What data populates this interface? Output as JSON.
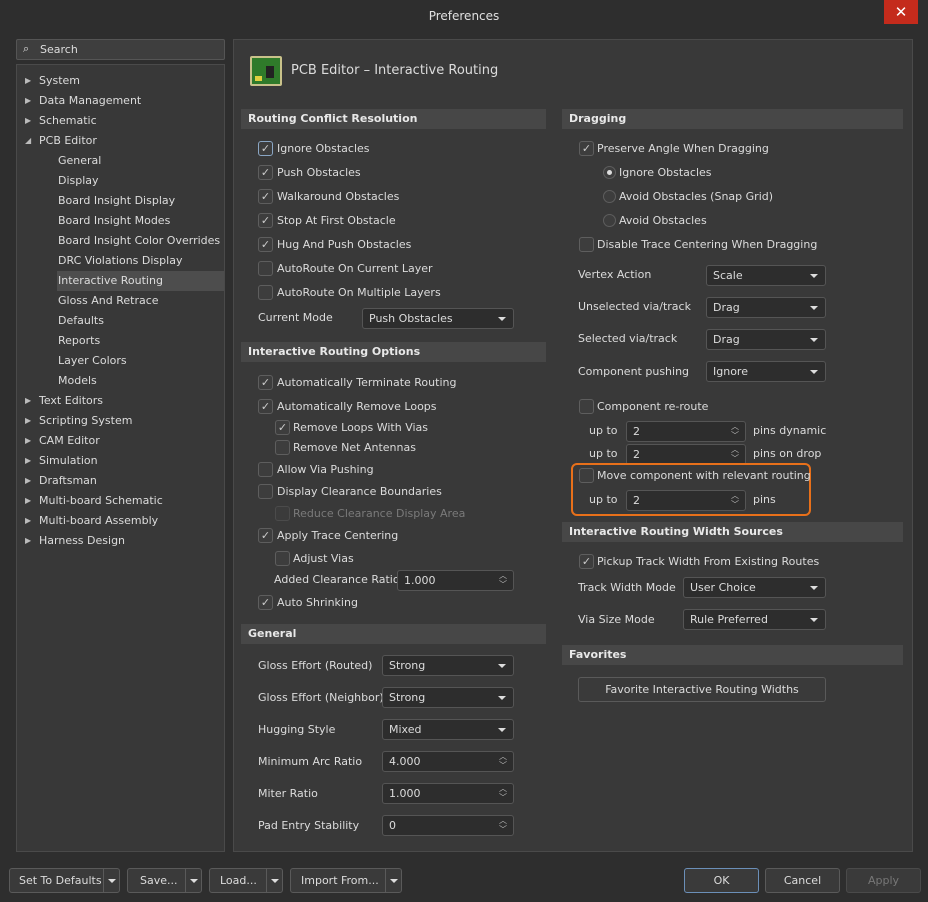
{
  "window": {
    "title": "Preferences",
    "close": "✕"
  },
  "search": {
    "placeholder": "Search"
  },
  "tree": [
    "System",
    "Data Management",
    "Schematic",
    "PCB Editor",
    "General",
    "Display",
    "Board Insight Display",
    "Board Insight Modes",
    "Board Insight Color Overrides",
    "DRC Violations Display",
    "Interactive Routing",
    "Gloss And Retrace",
    "Defaults",
    "Reports",
    "Layer Colors",
    "Models",
    "Text Editors",
    "Scripting System",
    "CAM Editor",
    "Simulation",
    "Draftsman",
    "Multi-board Schematic",
    "Multi-board Assembly",
    "Harness Design"
  ],
  "page_title": "PCB Editor – Interactive Routing",
  "rcr": {
    "title": "Routing Conflict Resolution",
    "items": [
      "Ignore Obstacles",
      "Push Obstacles",
      "Walkaround Obstacles",
      "Stop At First Obstacle",
      "Hug And Push Obstacles",
      "AutoRoute On Current Layer",
      "AutoRoute On Multiple Layers"
    ],
    "mode_label": "Current Mode",
    "mode_value": "Push Obstacles"
  },
  "iro": {
    "title": "Interactive Routing Options",
    "items": [
      "Automatically Terminate Routing",
      "Automatically Remove Loops",
      "Remove Loops With Vias",
      "Remove Net Antennas",
      "Allow Via Pushing",
      "Display Clearance Boundaries",
      "Reduce Clearance Display Area",
      "Apply Trace Centering",
      "Adjust Vias",
      "Auto Shrinking"
    ],
    "ratio_label": "Added Clearance Ratio",
    "ratio_value": "1.000"
  },
  "general": {
    "title": "General",
    "rows": [
      {
        "label": "Gloss Effort (Routed)",
        "value": "Strong"
      },
      {
        "label": "Gloss Effort (Neighbor)",
        "value": "Strong"
      },
      {
        "label": "Hugging Style",
        "value": "Mixed"
      },
      {
        "label": "Minimum Arc Ratio",
        "value": "4.000"
      },
      {
        "label": "Miter Ratio",
        "value": "1.000"
      },
      {
        "label": "Pad Entry Stability",
        "value": "0"
      }
    ]
  },
  "dragging": {
    "title": "Dragging",
    "preserve": "Preserve Angle When Dragging",
    "radios": [
      "Ignore Obstacles",
      "Avoid Obstacles (Snap Grid)",
      "Avoid Obstacles"
    ],
    "disable_centering": "Disable Trace Centering When Dragging",
    "rows": [
      {
        "label": "Vertex Action",
        "value": "Scale"
      },
      {
        "label": "Unselected via/track",
        "value": "Drag"
      },
      {
        "label": "Selected via/track",
        "value": "Drag"
      },
      {
        "label": "Component pushing",
        "value": "Ignore"
      }
    ],
    "reroute": "Component re-route",
    "up_to": "up to",
    "dyn_value": "2",
    "dyn_suffix": "pins dynamic",
    "drop_value": "2",
    "drop_suffix": "pins on drop",
    "move": "Move component with relevant routing",
    "move_value": "2",
    "move_suffix": "pins"
  },
  "width": {
    "title": "Interactive Routing Width Sources",
    "pickup": "Pickup Track Width From Existing Routes",
    "track_label": "Track Width Mode",
    "track_value": "User Choice",
    "via_label": "Via Size Mode",
    "via_value": "Rule Preferred"
  },
  "favorites": {
    "title": "Favorites",
    "button": "Favorite Interactive Routing Widths"
  },
  "footer": {
    "defaults": "Set To Defaults",
    "save": "Save...",
    "load": "Load...",
    "import": "Import From...",
    "ok": "OK",
    "cancel": "Cancel",
    "apply": "Apply"
  },
  "colors": {
    "highlight": "#e8701a"
  }
}
